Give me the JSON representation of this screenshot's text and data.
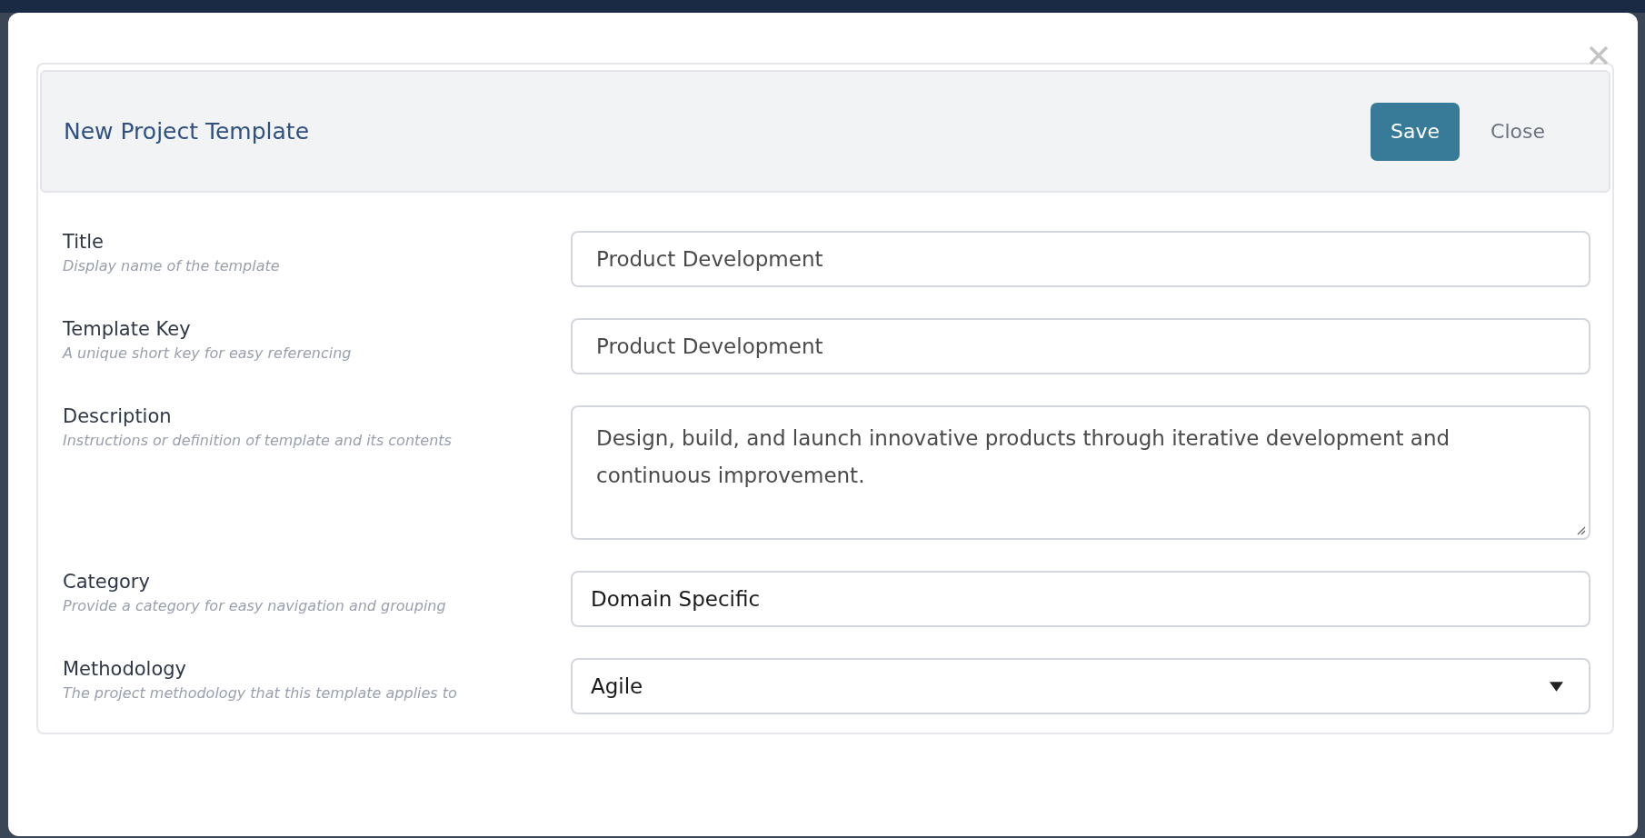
{
  "dialog": {
    "title": "New Project Template",
    "buttons": [
      {
        "label": "Save",
        "kind": "primary"
      },
      {
        "label": "Close",
        "kind": "link"
      }
    ],
    "fields": [
      {
        "label": "Title",
        "hint": "Display name of the template",
        "kind": "text",
        "value": "Product Development"
      },
      {
        "label": "Template Key",
        "hint": "A unique short key for easy referencing",
        "kind": "text",
        "value": "Product Development"
      },
      {
        "label": "Description",
        "hint": "Instructions or definition of template and its contents",
        "kind": "textarea",
        "value": "Design, build, and launch innovative products through iterative development and continuous improvement."
      },
      {
        "label": "Category",
        "hint": "Provide a category for easy navigation and grouping",
        "kind": "plain",
        "value": "Domain Specific"
      },
      {
        "label": "Methodology",
        "hint": "The project methodology that this template applies to",
        "kind": "select",
        "value": "Agile"
      }
    ]
  }
}
